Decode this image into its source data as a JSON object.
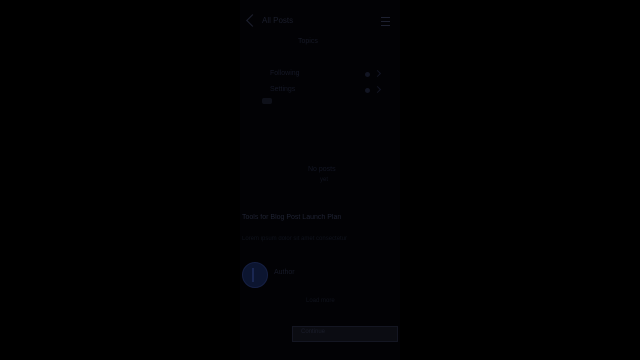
{
  "topbar": {
    "title": "All Posts"
  },
  "header": {
    "caption": "Topics"
  },
  "rows": [
    {
      "label": "Following"
    },
    {
      "label": "Settings"
    }
  ],
  "main": {
    "message": "No posts",
    "message_sub": "yet"
  },
  "article": {
    "title": "Tools for Blog Post Launch Plan",
    "subtitle": "Lorem ipsum dolor sit amet consectetur"
  },
  "profile": {
    "name": "Author"
  },
  "footer": {
    "link": "Load more"
  },
  "bottom_bar": {
    "label": "Continue"
  },
  "colors": {
    "background": "#000000",
    "phone": "#020205",
    "accent": "#0c1530"
  }
}
